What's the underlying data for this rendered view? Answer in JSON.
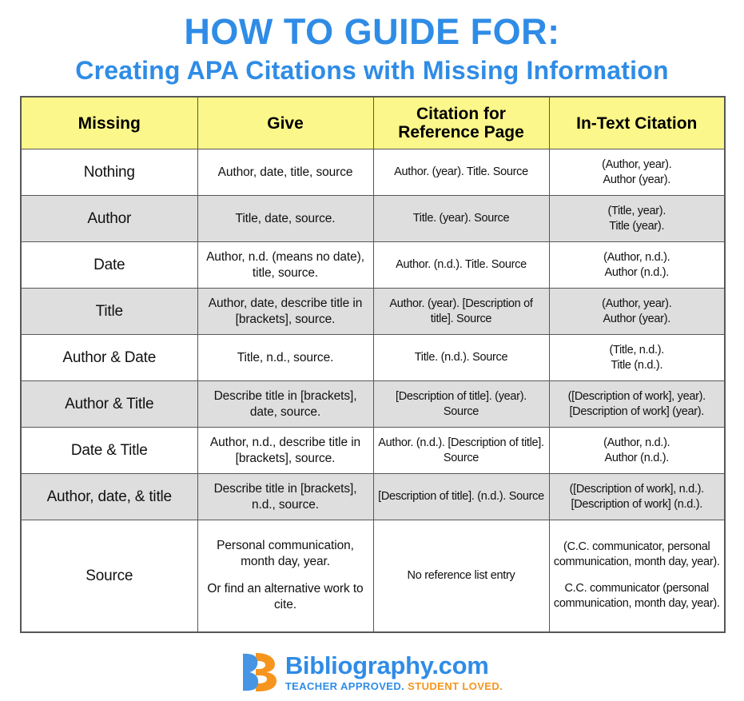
{
  "header": {
    "title_line1": "HOW TO GUIDE FOR:",
    "title_line2": "Creating APA Citations with Missing Information",
    "title_color": "#2f8ce6"
  },
  "table": {
    "header_bg": "#fbf78a",
    "alt_row_bg": "#dedede",
    "border_color": "#575757",
    "columns": [
      "Missing",
      "Give",
      "Citation for Reference Page",
      "In-Text Citation"
    ],
    "column_header_lines": [
      [
        "Missing"
      ],
      [
        "Give"
      ],
      [
        "Citation for",
        "Reference Page"
      ],
      [
        "In-Text Citation"
      ]
    ],
    "rows": [
      {
        "missing": "Nothing",
        "give": "Author, date, title, source",
        "reference": "Author. (year). Title. Source",
        "intext": "(Author, year).\nAuthor (year)."
      },
      {
        "missing": "Author",
        "give": "Title, date, source.",
        "reference": "Title. (year). Source",
        "intext": "(Title, year).\nTitle (year)."
      },
      {
        "missing": "Date",
        "give": "Author, n.d. (means no date), title, source.",
        "reference": "Author. (n.d.). Title. Source",
        "intext": "(Author, n.d.).\nAuthor (n.d.)."
      },
      {
        "missing": "Title",
        "give": "Author, date, describe title in [brackets], source.",
        "reference": "Author. (year). [Description of title]. Source",
        "intext": "(Author, year).\nAuthor (year)."
      },
      {
        "missing": "Author & Date",
        "give": "Title, n.d., source.",
        "reference": "Title. (n.d.). Source",
        "intext": "(Title, n.d.).\nTitle (n.d.)."
      },
      {
        "missing": "Author & Title",
        "give": "Describe title in [brackets], date, source.",
        "reference": "[Description of title]. (year). Source",
        "intext": "([Description of work], year).\n[Description of work] (year)."
      },
      {
        "missing": "Date & Title",
        "give": "Author, n.d., describe title in [brackets], source.",
        "reference": "Author. (n.d.). [Description of title]. Source",
        "intext": "(Author, n.d.).\nAuthor (n.d.)."
      },
      {
        "missing": "Author, date, & title",
        "give": "Describe title in [brackets], n.d., source.",
        "reference": "[Description of title]. (n.d.). Source",
        "intext": "([Description of work], n.d.).\n[Description of work] (n.d.)."
      },
      {
        "missing": "Source",
        "give_part1": "Personal communication, month day, year.",
        "give_part2": "Or find an alternative work to cite.",
        "reference": "No reference list entry",
        "intext_part1": "(C.C. communicator, personal communication, month day, year).",
        "intext_part2": "C.C. communicator (personal communication, month day, year)."
      }
    ]
  },
  "footer": {
    "logo_icon": "bibliography-b-logo-icon",
    "brand": "Bibliography.com",
    "tagline_part1": "TEACHER APPROVED.",
    "tagline_part2": "STUDENT LOVED.",
    "brand_color": "#2f8ce6",
    "accent_color": "#f6951e"
  }
}
